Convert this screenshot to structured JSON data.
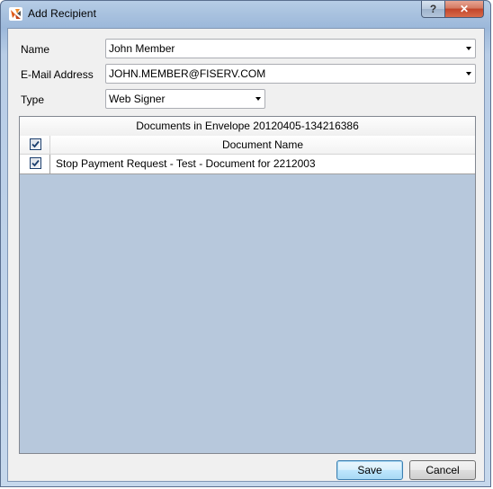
{
  "window": {
    "title": "Add Recipient",
    "help_symbol": "?",
    "close_symbol": "✕"
  },
  "form": {
    "name_label": "Name",
    "name_value": "John Member",
    "email_label": "E-Mail Address",
    "email_value": "JOHN.MEMBER@FISERV.COM",
    "type_label": "Type",
    "type_value": "Web Signer"
  },
  "documents": {
    "caption": "Documents in Envelope 20120405-134216386",
    "header_name": "Document Name",
    "header_checked": true,
    "rows": [
      {
        "checked": true,
        "name": "Stop Payment Request - Test - Document for 2212003"
      }
    ]
  },
  "buttons": {
    "save": "Save",
    "cancel": "Cancel"
  },
  "colors": {
    "grid_background": "#b7c8dc",
    "check_mark": "#1c3f6e"
  }
}
